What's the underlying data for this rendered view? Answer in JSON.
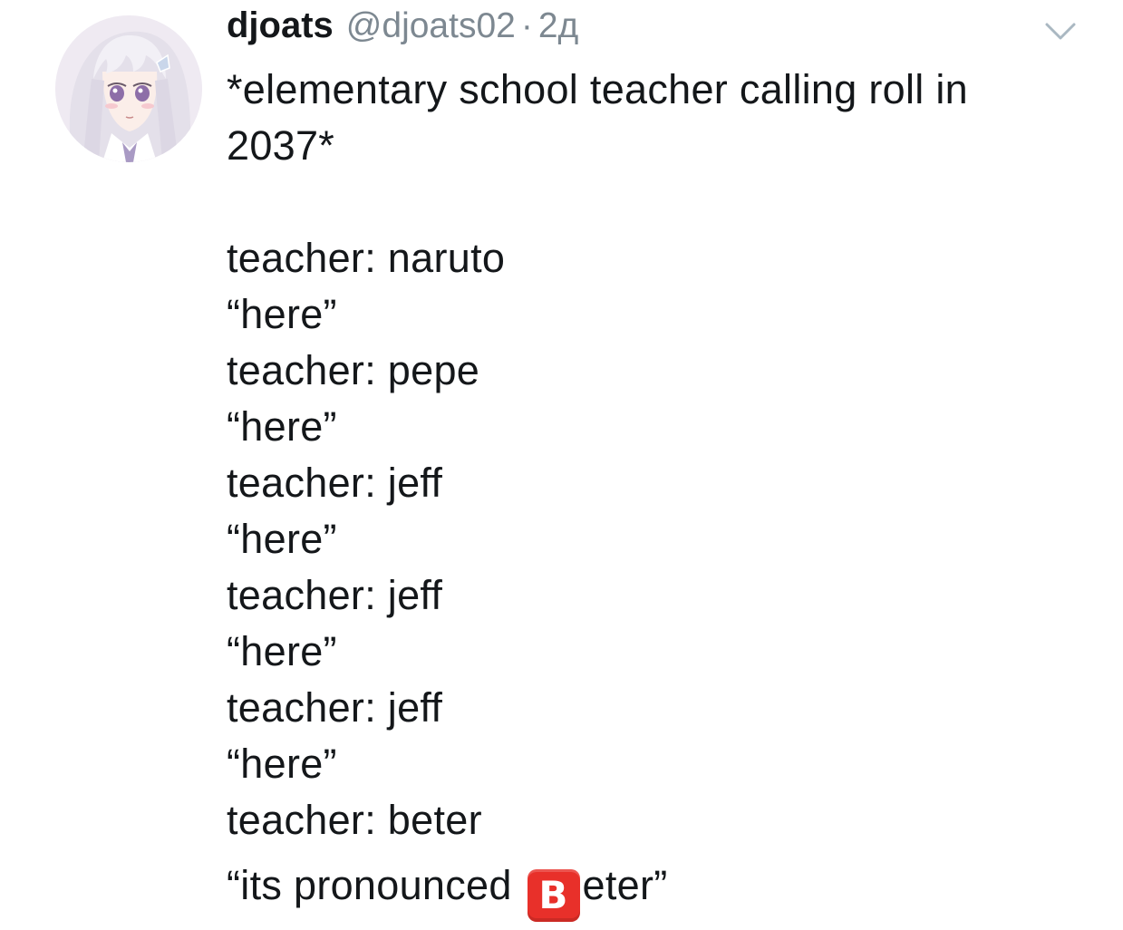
{
  "author": {
    "display_name": "djoats",
    "handle": "@djoats02",
    "separator": "·",
    "timestamp": "2д",
    "avatar_icon": "anime-girl-avatar-icon"
  },
  "menu": {
    "caret_icon": "chevron-down-icon",
    "caret_color": "#aab8c2"
  },
  "tweet": {
    "title_line_1": "*elementary school teacher calling roll in",
    "title_line_2": "2037*",
    "lines": [
      "teacher: naruto",
      "“here”",
      "teacher: pepe",
      "“here”",
      "teacher: jeff",
      "“here”",
      "teacher: jeff",
      "“here”",
      "teacher: jeff",
      "“here”",
      "teacher: beter"
    ],
    "final_line": {
      "before": "“its pronounced ",
      "emoji_letter": "B",
      "emoji_name": "b-button-emoji",
      "emoji_color": "#e8302a",
      "after": "eter”"
    }
  },
  "colors": {
    "text": "#14171a",
    "secondary": "#7d8891",
    "background": "#ffffff"
  }
}
